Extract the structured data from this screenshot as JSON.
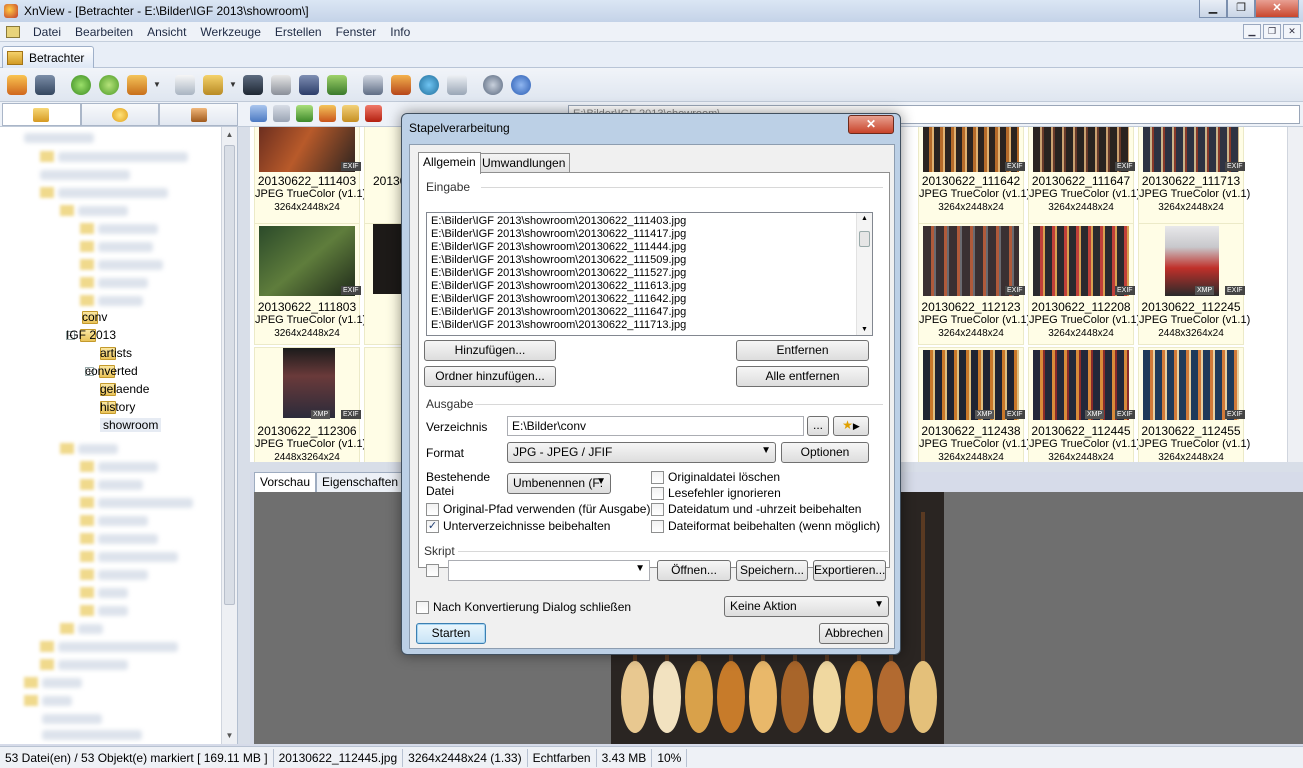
{
  "window": {
    "title": "XnView - [Betrachter - E:\\Bilder\\IGF 2013\\showroom\\]",
    "minimize": "▁",
    "maximize": "❐",
    "close": "✕"
  },
  "menu": [
    "Datei",
    "Bearbeiten",
    "Ansicht",
    "Werkzeuge",
    "Erstellen",
    "Fenster",
    "Info"
  ],
  "doc_tab": "Betrachter",
  "path_bar": "E:\\Bilder\\IGF 2013\\showroom\\",
  "tree": {
    "visible_nodes": [
      {
        "label": "conv",
        "level": 1,
        "expander": ""
      },
      {
        "label": "IGF 2013",
        "level": 1,
        "expander": "−"
      },
      {
        "label": "artists",
        "level": 2,
        "expander": ""
      },
      {
        "label": "converted",
        "level": 2,
        "expander": "+"
      },
      {
        "label": "gelaende",
        "level": 2,
        "expander": ""
      },
      {
        "label": "history",
        "level": 2,
        "expander": ""
      },
      {
        "label": "showroom",
        "level": 2,
        "expander": "",
        "selected": true
      }
    ]
  },
  "thumbnails": [
    {
      "name": "20130622_111403",
      "format": "JPEG TrueColor (v1.1)",
      "dims": "3264x2448x24",
      "badge": "EXIF"
    },
    {
      "name": "20130622_111642",
      "format": "JPEG TrueColor (v1.1)",
      "dims": "3264x2448x24",
      "badge": "EXIF"
    },
    {
      "name": "20130622_111647",
      "format": "JPEG TrueColor (v1.1)",
      "dims": "3264x2448x24",
      "badge": "EXIF"
    },
    {
      "name": "20130622_111713",
      "format": "JPEG TrueColor (v1.1)",
      "dims": "3264x2448x24",
      "badge": "EXIF"
    },
    {
      "name": "20130622_111803",
      "format": "JPEG TrueColor (v1.1)",
      "dims": "3264x2448x24",
      "badge": "EXIF"
    },
    {
      "name": "20130622_112123",
      "format": "JPEG TrueColor (v1.1)",
      "dims": "3264x2448x24",
      "badge": "EXIF"
    },
    {
      "name": "20130622_112208",
      "format": "JPEG TrueColor (v1.1)",
      "dims": "3264x2448x24",
      "badge": "EXIF"
    },
    {
      "name": "20130622_112245",
      "format": "JPEG TrueColor (v1.1)",
      "dims": "2448x3264x24",
      "badge": "EXIF"
    },
    {
      "name": "20130622_112306",
      "format": "JPEG TrueColor (v1.1)",
      "dims": "2448x3264x24",
      "badge": "EXIF"
    },
    {
      "name": "20130622_112438",
      "format": "JPEG TrueColor (v1.1)",
      "dims": "3264x2448x24",
      "badge": "EXIF"
    },
    {
      "name": "20130622_112445",
      "format": "JPEG TrueColor (v1.1)",
      "dims": "3264x2448x24",
      "badge": "EXIF"
    },
    {
      "name": "20130622_112455",
      "format": "JPEG TrueColor (v1.1)",
      "dims": "3264x2448x24",
      "badge": "EXIF"
    }
  ],
  "partial_thumb_label": "20130",
  "preview_tabs": [
    "Vorschau",
    "Eigenschaften"
  ],
  "status": [
    "53 Datei(en) / 53 Objekt(e) markiert  [ 169.11 MB ]",
    "20130622_112445.jpg",
    "3264x2448x24 (1.33)",
    "Echtfarben",
    "3.43 MB",
    "10%"
  ],
  "dialog": {
    "title": "Stapelverarbeitung",
    "close": "✕",
    "tabs": [
      "Allgemein",
      "Umwandlungen"
    ],
    "input_group": "Eingabe",
    "files": [
      "E:\\Bilder\\IGF 2013\\showroom\\20130622_111403.jpg",
      "E:\\Bilder\\IGF 2013\\showroom\\20130622_111417.jpg",
      "E:\\Bilder\\IGF 2013\\showroom\\20130622_111444.jpg",
      "E:\\Bilder\\IGF 2013\\showroom\\20130622_111509.jpg",
      "E:\\Bilder\\IGF 2013\\showroom\\20130622_111527.jpg",
      "E:\\Bilder\\IGF 2013\\showroom\\20130622_111613.jpg",
      "E:\\Bilder\\IGF 2013\\showroom\\20130622_111642.jpg",
      "E:\\Bilder\\IGF 2013\\showroom\\20130622_111647.jpg",
      "E:\\Bilder\\IGF 2013\\showroom\\20130622_111713.jpg"
    ],
    "add_button": "Hinzufügen...",
    "remove_button": "Entfernen",
    "add_folder_button": "Ordner hinzufügen...",
    "remove_all_button": "Alle entfernen",
    "output_group": "Ausgabe",
    "directory_label": "Verzeichnis",
    "directory_value": "E:\\Bilder\\conv",
    "browse_button": "...",
    "format_label": "Format",
    "format_value": "JPG - JPEG / JFIF",
    "options_button": "Optionen",
    "existing_label_1": "Bestehende",
    "existing_label_2": "Datei",
    "existing_value": "Umbenennen  (F:",
    "checks": [
      {
        "label": "Originaldatei löschen",
        "checked": false
      },
      {
        "label": "Lesefehler ignorieren",
        "checked": false
      },
      {
        "label": "Original-Pfad verwenden (für Ausgabe)",
        "checked": false
      },
      {
        "label": "Dateidatum und -uhrzeit beibehalten",
        "checked": false
      },
      {
        "label": "Unterverzeichnisse beibehalten",
        "checked": true
      },
      {
        "label": "Dateiformat beibehalten (wenn möglich)",
        "checked": false
      }
    ],
    "script_group": "Skript",
    "script_value": "",
    "open_button": "Öffnen...",
    "save_button": "Speichern...",
    "export_button": "Exportieren...",
    "close_after_label": "Nach Konvertierung Dialog schließen",
    "after_action_value": "Keine Aktion",
    "start_button": "Starten",
    "cancel_button": "Abbrechen",
    "check_mark": "✓",
    "dropdown_arrow": "▼"
  }
}
